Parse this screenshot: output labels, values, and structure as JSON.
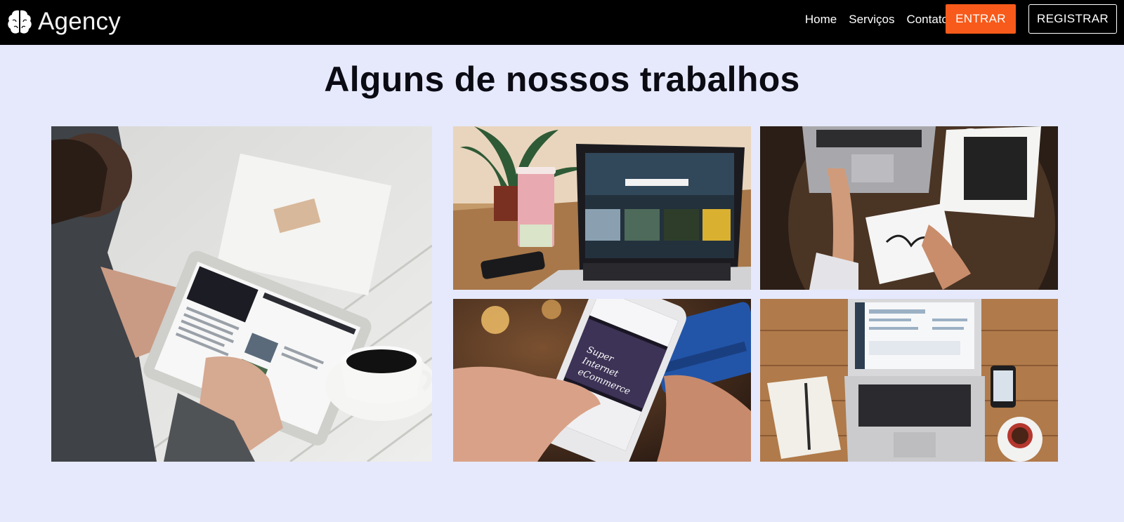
{
  "brand": {
    "name": "Agency",
    "icon": "brain-icon"
  },
  "nav": {
    "links": [
      "Home",
      "Serviços",
      "Contato"
    ],
    "login_label": "ENTRAR",
    "register_label": "REGISTRAR",
    "accent_color": "#f75a1a"
  },
  "portfolio": {
    "title": "Alguns de nossos trabalhos",
    "photo_subjects": [
      "tablet-coffee-photo",
      "laptop-plant-photo",
      "laptop-drawing-photo",
      "smartphone-ecommerce-photo",
      "laptop-notebook-photo"
    ]
  },
  "colors": {
    "navbar": "#000000",
    "page_background": "#e6e9fc"
  }
}
